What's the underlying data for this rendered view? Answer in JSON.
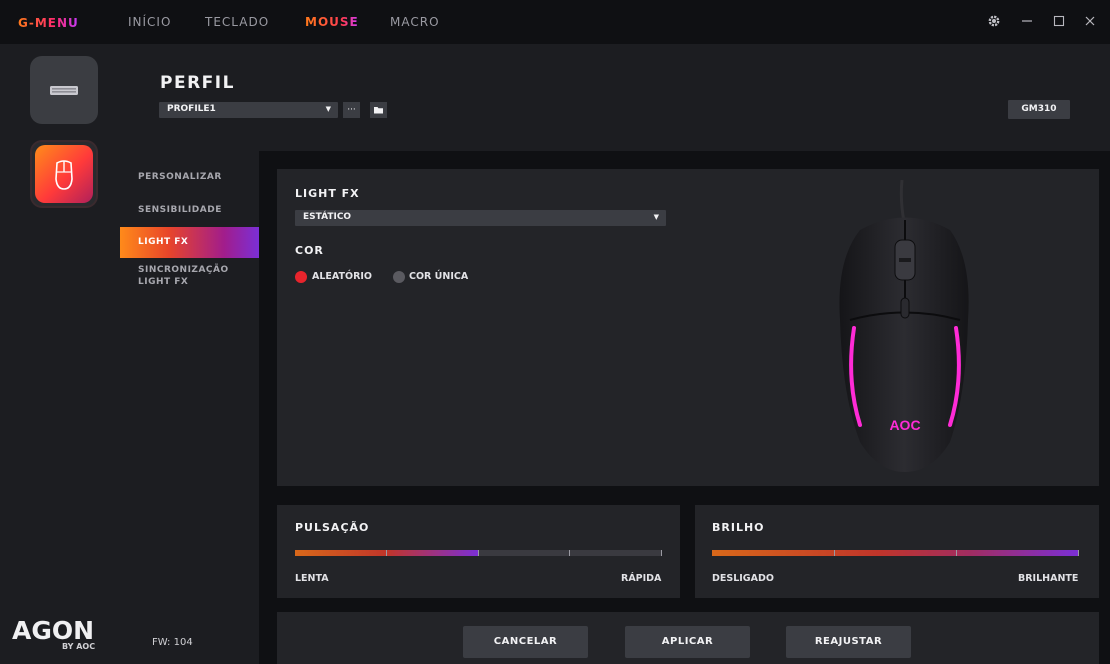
{
  "topbar": {
    "brand": "G-MENU",
    "nav": [
      "INÍCIO",
      "TECLADO",
      "MOUSE",
      "MACRO"
    ],
    "active_nav": "MOUSE",
    "accent_colors": [
      "#ff7a1a",
      "#ff2a6d",
      "#c23cff"
    ]
  },
  "leftrail": {
    "logo_main": "AGON",
    "logo_sub": "BY AOC"
  },
  "header": {
    "title": "PERFIL",
    "profile_value": "PROFILE1",
    "more_label": "···",
    "model": "GM310"
  },
  "submenu": {
    "items": [
      "PERSONALIZAR",
      "SENSIBILIDADE",
      "LIGHT FX",
      "SINCRONIZAÇÃO",
      "LIGHT FX"
    ],
    "active": "LIGHT FX",
    "fw": "FW: 104"
  },
  "lightfx": {
    "title": "LIGHT FX",
    "effect_value": "ESTÁTICO",
    "color_title": "COR",
    "radio_random": "ALEATÓRIO",
    "radio_single": "COR ÚNICA",
    "selected_color_mode": "ALEATÓRIO",
    "mouse_logo": "AOC"
  },
  "pulsacao": {
    "title": "PULSAÇÃO",
    "min_label": "LENTA",
    "max_label": "RÁPIDA",
    "level": 0.5
  },
  "brilho": {
    "title": "BRILHO",
    "min_label": "DESLIGADO",
    "max_label": "BRILHANTE",
    "level": 1.0
  },
  "footer": {
    "cancel": "CANCELAR",
    "apply": "APLICAR",
    "reset": "REAJUSTAR"
  }
}
